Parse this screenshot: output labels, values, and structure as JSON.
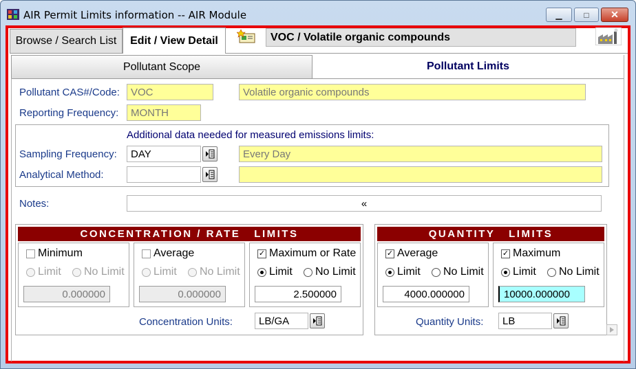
{
  "window": {
    "title": "AIR Permit Limits information -- AIR Module",
    "icon": "film-strip-icon",
    "controls": {
      "minimize": "▁",
      "restore": "□",
      "close": "✕"
    }
  },
  "tabs": {
    "browse": "Browse / Search List",
    "edit": "Edit / View Detail",
    "active": "edit"
  },
  "header": {
    "record": "VOC / Volatile organic compounds"
  },
  "subtabs": {
    "scope": "Pollutant Scope",
    "limits": "Pollutant Limits",
    "active": "limits"
  },
  "pollutant": {
    "cas_label": "Pollutant CAS#/Code:",
    "cas_value": "VOC",
    "cas_desc": "Volatile organic compounds",
    "freq_label": "Reporting Frequency:",
    "freq_value": "MONTH"
  },
  "measured": {
    "heading": "Additional data needed for measured emissions limits:",
    "sampling_label": "Sampling Frequency:",
    "sampling_value": "DAY",
    "sampling_desc": "Every Day",
    "method_label": "Analytical Method:",
    "method_value": "",
    "method_desc": ""
  },
  "notes": {
    "label": "Notes:",
    "value": "«"
  },
  "concentration": {
    "banner": "CONCENTRATION / RATE   LIMITS",
    "units_label": "Concentration Units:",
    "units_value": "LB/GA",
    "cells": [
      {
        "label": "Minimum",
        "checked": false,
        "enabled": false,
        "limit_label": "Limit",
        "nolimit_label": "No Limit",
        "selected": "none",
        "value": "0.000000"
      },
      {
        "label": "Average",
        "checked": false,
        "enabled": false,
        "limit_label": "Limit",
        "nolimit_label": "No Limit",
        "selected": "none",
        "value": "0.000000"
      },
      {
        "label": "Maximum or Rate",
        "checked": true,
        "enabled": true,
        "limit_label": "Limit",
        "nolimit_label": "No Limit",
        "selected": "limit",
        "value": "2.500000"
      }
    ]
  },
  "quantity": {
    "banner": "QUANTITY   LIMITS",
    "units_label": "Quantity Units:",
    "units_value": "LB",
    "cells": [
      {
        "label": "Average",
        "checked": true,
        "enabled": true,
        "limit_label": "Limit",
        "nolimit_label": "No Limit",
        "selected": "limit",
        "value": "4000.000000"
      },
      {
        "label": "Maximum",
        "checked": true,
        "enabled": true,
        "limit_label": "Limit",
        "nolimit_label": "No Limit",
        "selected": "limit",
        "value": "10000.000000"
      }
    ]
  },
  "colors": {
    "frame_border": "#e8000a",
    "banner": "#8b0000",
    "required_field": "#ffff99",
    "active_field": "#a8ffff",
    "label": "#1a3a8a"
  }
}
